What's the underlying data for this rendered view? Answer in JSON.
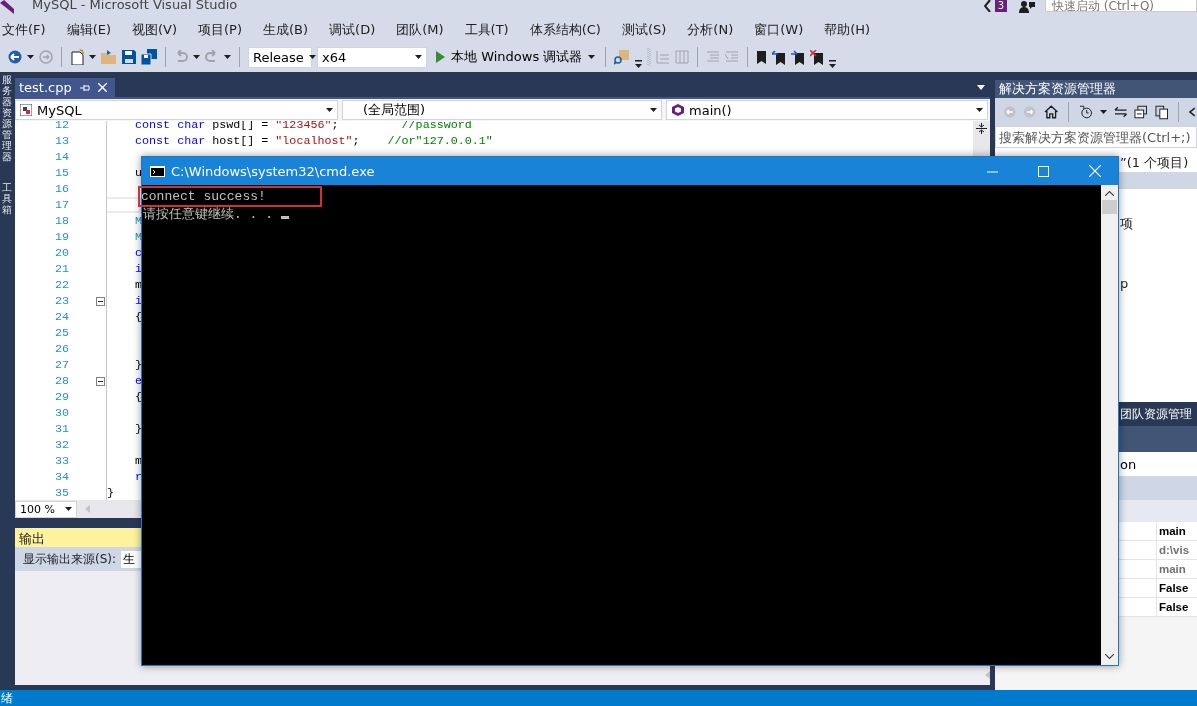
{
  "window": {
    "title": "MySQL - Microsoft Visual Studio",
    "notifications": "3",
    "quick_launch": {
      "placeholder": "快速启动 (Ctrl+Q)"
    }
  },
  "menu": [
    "文件(F)",
    "编辑(E)",
    "视图(V)",
    "项目(P)",
    "生成(B)",
    "调试(D)",
    "团队(M)",
    "工具(T)",
    "体系结构(C)",
    "测试(S)",
    "分析(N)",
    "窗口(W)",
    "帮助(H)"
  ],
  "toolbar": {
    "configuration": "Release",
    "platform": "x64",
    "start": "本地 Windows 调试器"
  },
  "side_tabs": [
    "服务器资源管理器",
    "工具箱"
  ],
  "editor": {
    "tabs": [
      {
        "label": "test.cpp",
        "selected": true
      }
    ],
    "navigation": [
      "MySQL",
      "(全局范围)",
      "main()"
    ],
    "lines": [
      {
        "number": "12",
        "fold": false,
        "current": false,
        "tokens": [
          {
            "kind": "keyword",
            "text": "    const"
          },
          {
            "kind": "keyword",
            "text": " char"
          },
          {
            "kind": "plain",
            "text": " pswd[] = "
          },
          {
            "kind": "string",
            "text": "\"123456\""
          },
          {
            "kind": "plain",
            "text": ";"
          },
          {
            "kind": "comment",
            "text": "         //password"
          }
        ]
      },
      {
        "number": "13",
        "fold": false,
        "current": false,
        "tokens": [
          {
            "kind": "keyword",
            "text": "    const"
          },
          {
            "kind": "keyword",
            "text": " char"
          },
          {
            "kind": "plain",
            "text": " host[] = "
          },
          {
            "kind": "string",
            "text": "\"localhost\""
          },
          {
            "kind": "plain",
            "text": ";"
          },
          {
            "kind": "comment",
            "text": "    //or\"127.0.0.1\""
          }
        ]
      },
      {
        "number": "14",
        "fold": false,
        "current": false
      },
      {
        "number": "15",
        "fold": false,
        "current": false,
        "tokens": [
          {
            "kind": "plain",
            "text": "    u"
          }
        ]
      },
      {
        "number": "16",
        "fold": false,
        "current": false
      },
      {
        "number": "17",
        "fold": false,
        "current": true
      },
      {
        "number": "18",
        "fold": false,
        "current": false,
        "tokens": [
          {
            "kind": "type",
            "text": "    M"
          }
        ]
      },
      {
        "number": "19",
        "fold": false,
        "current": false,
        "tokens": [
          {
            "kind": "type",
            "text": "    M"
          }
        ]
      },
      {
        "number": "20",
        "fold": false,
        "current": false,
        "tokens": [
          {
            "kind": "keyword",
            "text": "    c"
          }
        ]
      },
      {
        "number": "21",
        "fold": false,
        "current": false,
        "tokens": [
          {
            "kind": "keyword",
            "text": "    i"
          }
        ]
      },
      {
        "number": "22",
        "fold": false,
        "current": false,
        "tokens": [
          {
            "kind": "plain",
            "text": "    m"
          }
        ]
      },
      {
        "number": "23",
        "fold": true,
        "current": false,
        "tokens": [
          {
            "kind": "keyword",
            "text": "    i"
          }
        ]
      },
      {
        "number": "24",
        "fold": false,
        "current": false,
        "tokens": [
          {
            "kind": "plain",
            "text": "    {"
          }
        ]
      },
      {
        "number": "25",
        "fold": false,
        "current": false
      },
      {
        "number": "26",
        "fold": false,
        "current": false
      },
      {
        "number": "27",
        "fold": false,
        "current": false,
        "tokens": [
          {
            "kind": "plain",
            "text": "    }"
          }
        ]
      },
      {
        "number": "28",
        "fold": true,
        "current": false,
        "tokens": [
          {
            "kind": "keyword",
            "text": "    e"
          }
        ]
      },
      {
        "number": "29",
        "fold": false,
        "current": false,
        "tokens": [
          {
            "kind": "plain",
            "text": "    {"
          }
        ]
      },
      {
        "number": "30",
        "fold": false,
        "current": false
      },
      {
        "number": "31",
        "fold": false,
        "current": false,
        "tokens": [
          {
            "kind": "plain",
            "text": "    }"
          }
        ]
      },
      {
        "number": "32",
        "fold": false,
        "current": false
      },
      {
        "number": "33",
        "fold": false,
        "current": false,
        "tokens": [
          {
            "kind": "plain",
            "text": "    m"
          }
        ]
      },
      {
        "number": "34",
        "fold": false,
        "current": false,
        "tokens": [
          {
            "kind": "keyword",
            "text": "    r"
          }
        ]
      },
      {
        "number": "35",
        "fold": false,
        "current": false,
        "tokens": [
          {
            "kind": "plain",
            "text": "}"
          }
        ]
      }
    ],
    "zoom": "100 %"
  },
  "output": {
    "title": "输出",
    "source_label": "显示输出来源(S):",
    "source_value": "生"
  },
  "solution_explorer": {
    "title": "解决方案资源管理器",
    "search": {
      "placeholder": "搜索解决方案资源管理器(Ctrl+;)"
    },
    "items": [
      "”(1 个项目)",
      "项",
      "p"
    ]
  },
  "team_explorer_tab": "团队资源管理",
  "properties": {
    "object": "on",
    "values": [
      {
        "text": "main",
        "disabled": false
      },
      {
        "text": "d:\\vis",
        "disabled": true
      },
      {
        "text": "main",
        "disabled": true
      },
      {
        "text": "False",
        "disabled": false
      },
      {
        "text": "False",
        "disabled": false
      }
    ]
  },
  "console": {
    "title": "C:\\Windows\\system32\\cmd.exe",
    "lines": [
      {
        "text": "connect success!",
        "highlighted": true
      },
      {
        "text": "请按任意键继续. . . ",
        "highlighted": false
      }
    ]
  },
  "status_bar": "绪"
}
